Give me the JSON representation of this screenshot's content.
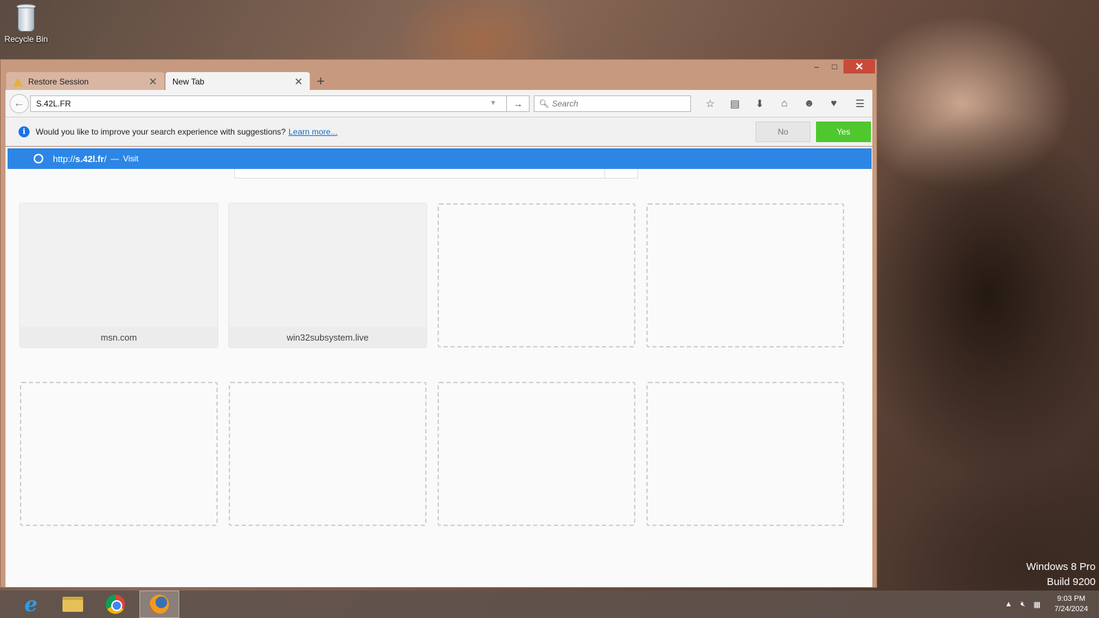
{
  "desktop": {
    "recycle_bin_label": "Recycle Bin",
    "watermark": {
      "line1": "Windows 8 Pro",
      "line2": "Build 9200"
    }
  },
  "browser": {
    "tabs": [
      {
        "label": "Restore Session",
        "active": false,
        "icon": "warning-icon"
      },
      {
        "label": "New Tab",
        "active": true
      }
    ],
    "new_tab_label": "+",
    "window_controls": {
      "minimize": "–",
      "maximize": "□",
      "close": "✕"
    },
    "urlbar": {
      "value": "S.42L.FR"
    },
    "searchbar": {
      "placeholder": "Search"
    },
    "toolbar_icons": [
      "bookmark-star-icon",
      "reading-list-icon",
      "download-icon",
      "home-icon",
      "hello-icon",
      "pocket-icon",
      "menu-icon"
    ],
    "notification": {
      "text": "Would you like to improve your search experience with suggestions?",
      "link": "Learn more...",
      "no_label": "No",
      "yes_label": "Yes"
    },
    "suggestion": {
      "url_prefix": "http://",
      "url_host": "s.42l.fr",
      "url_suffix": "/",
      "separator": "—",
      "action": "Visit"
    },
    "tiles": [
      {
        "label": "msn.com",
        "filled": true
      },
      {
        "label": "win32subsystem.live",
        "filled": true
      },
      {
        "label": "",
        "filled": false
      },
      {
        "label": "",
        "filled": false
      },
      {
        "label": "",
        "filled": false
      },
      {
        "label": "",
        "filled": false
      },
      {
        "label": "",
        "filled": false
      },
      {
        "label": "",
        "filled": false
      }
    ]
  },
  "taskbar": {
    "apps": [
      "internet-explorer-icon",
      "file-explorer-icon",
      "chrome-icon",
      "firefox-icon"
    ],
    "active_app": "firefox-icon",
    "clock": {
      "time": "9:03 PM",
      "date": "7/24/2024"
    }
  },
  "colors": {
    "accent_blue": "#2d86e6",
    "yes_green": "#4fc82e",
    "close_red": "#c84a3a"
  }
}
